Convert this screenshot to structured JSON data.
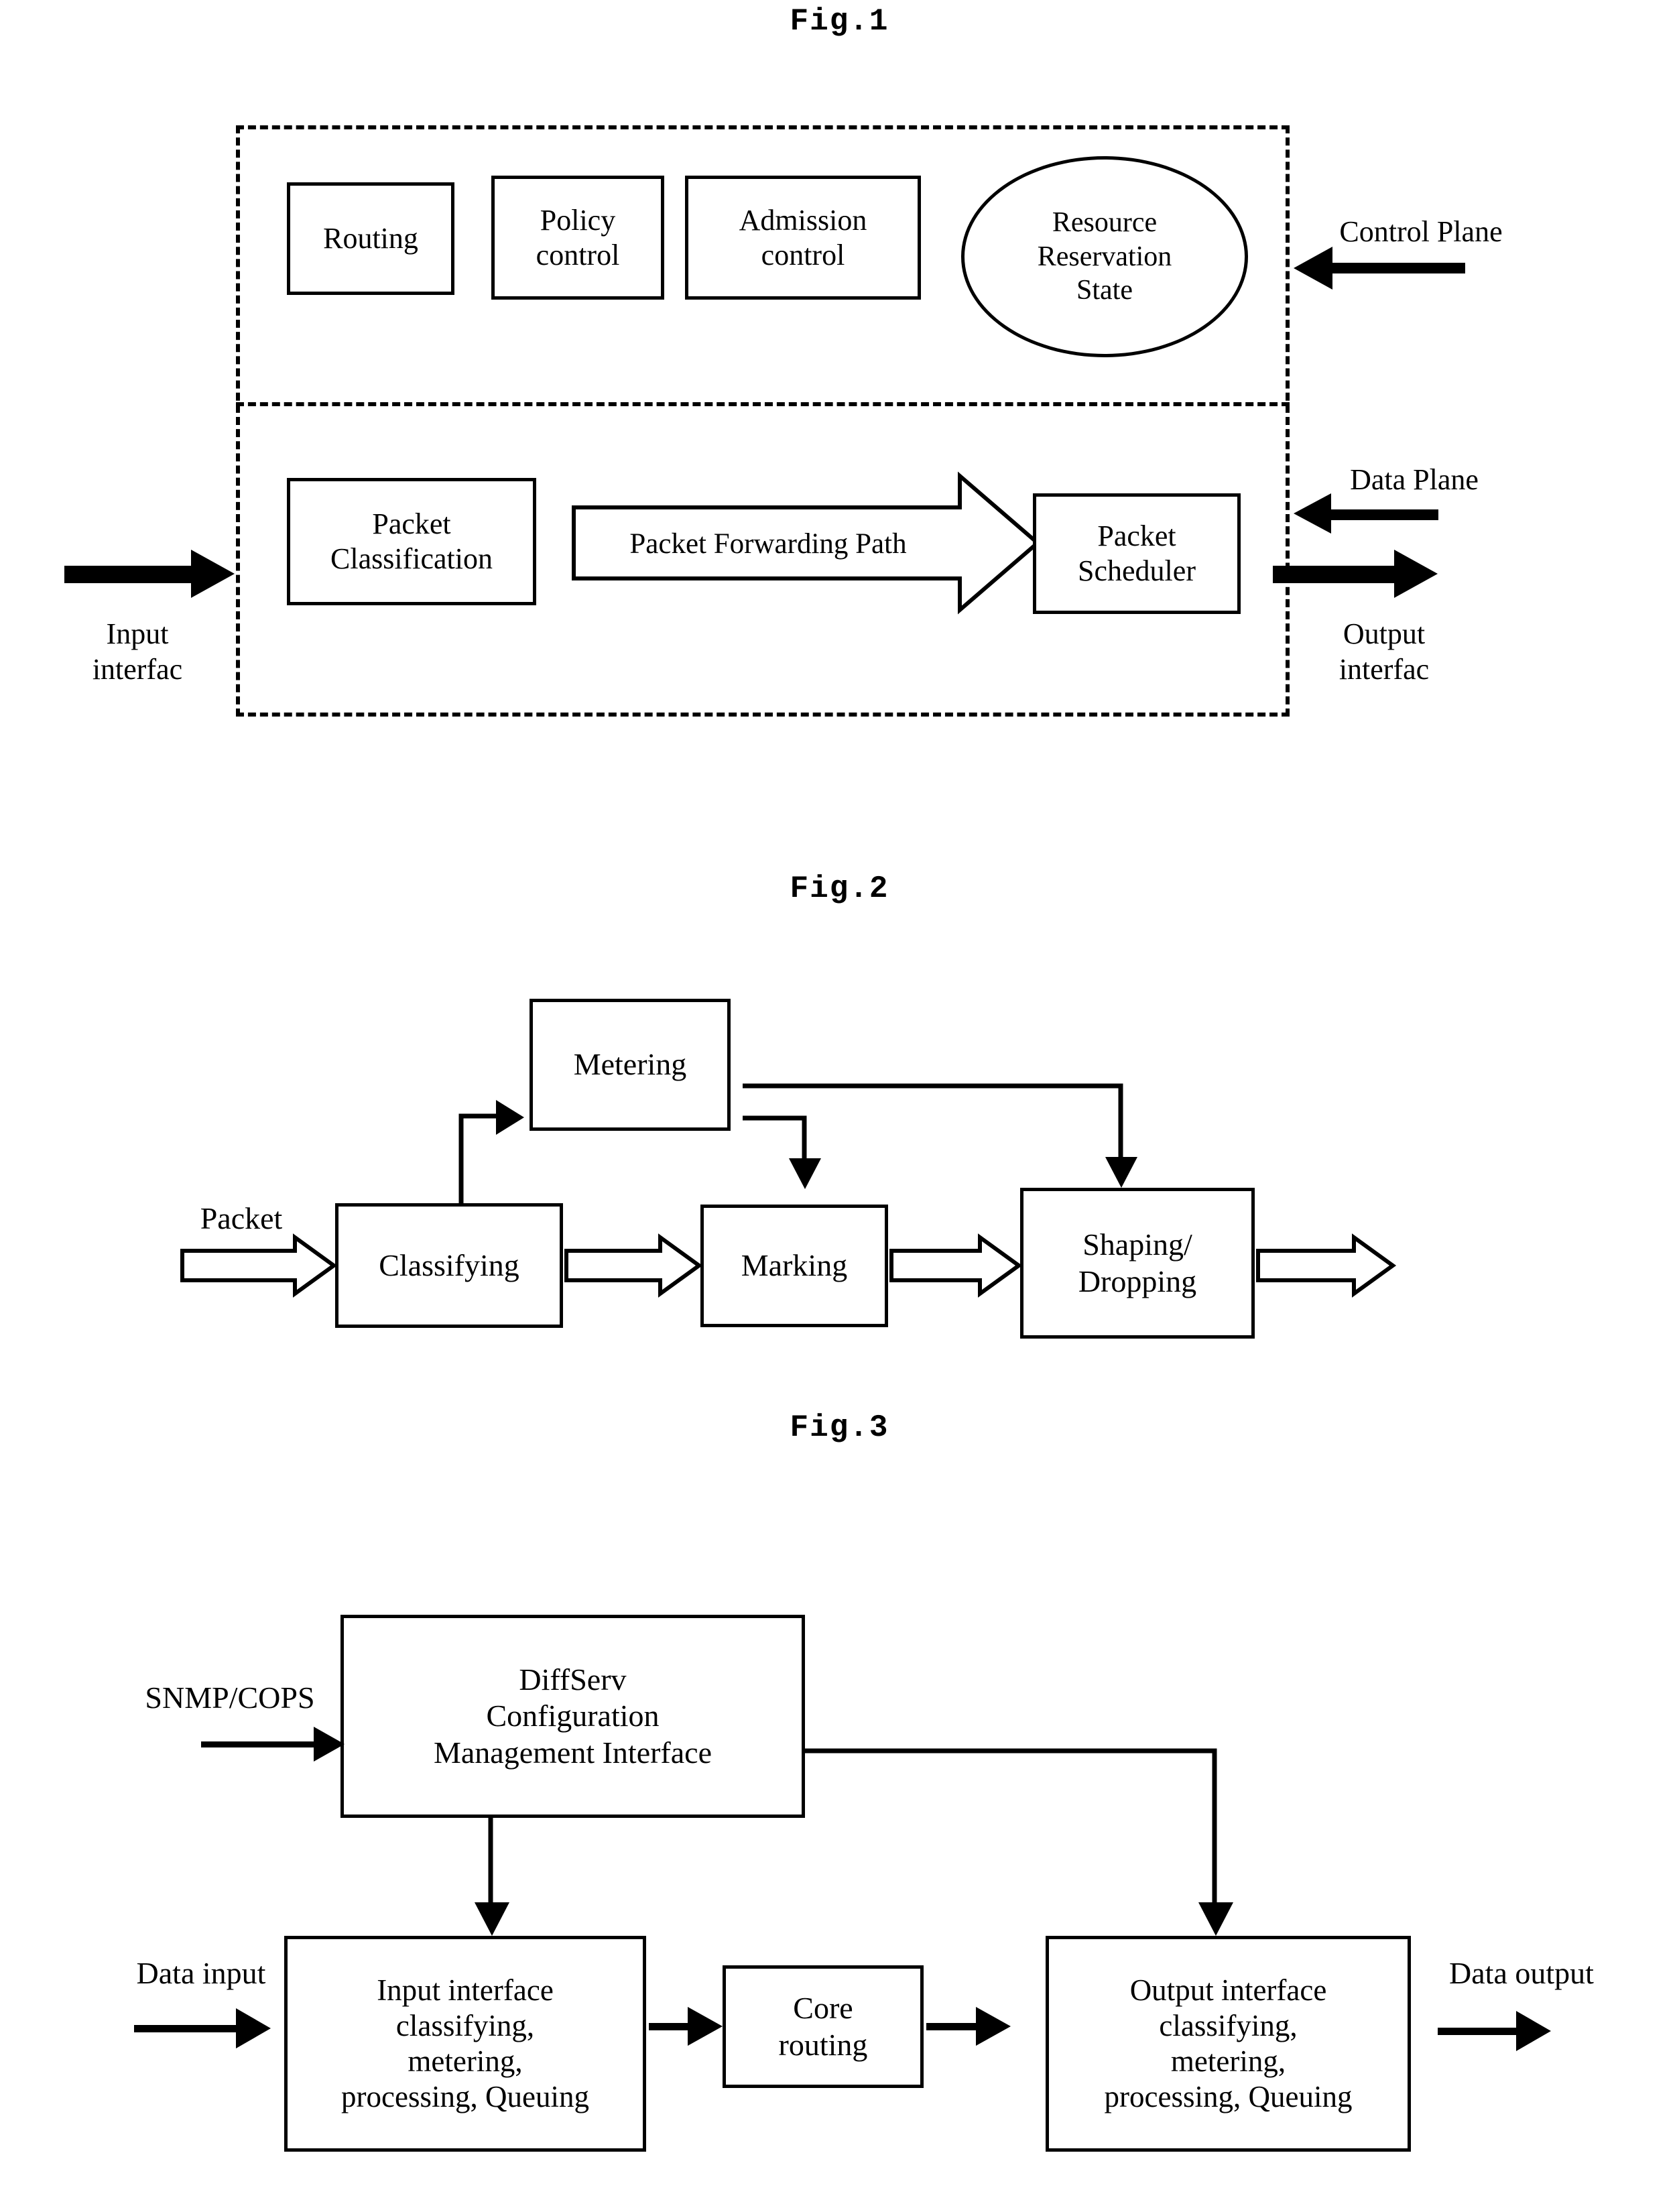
{
  "figures": [
    {
      "caption": "Fig.1",
      "control_plane": {
        "label": "Control Plane",
        "blocks": [
          {
            "label": "Routing"
          },
          {
            "label": "Policy\ncontrol"
          },
          {
            "label": "Admission\ncontrol"
          }
        ],
        "ellipse": {
          "label": "Resource\nReservation\nState"
        }
      },
      "data_plane": {
        "label": "Data Plane",
        "blocks": [
          {
            "label": "Packet\nClassification"
          },
          {
            "label": "Packet Forwarding Path"
          },
          {
            "label": "Packet\nScheduler"
          }
        ]
      },
      "input_label": "Input\ninterfac",
      "output_label": "Output\ninterfac"
    },
    {
      "caption": "Fig.2",
      "blocks": [
        {
          "label": "Metering"
        },
        {
          "label": "Classifying"
        },
        {
          "label": "Marking"
        },
        {
          "label": "Shaping/\nDropping"
        }
      ],
      "input_label": "Packet"
    },
    {
      "caption": "Fig.3",
      "blocks": [
        {
          "label": "DiffServ\nConfiguration\nManagement Interface"
        },
        {
          "label": "Input interface\nclassifying,\nmetering,\nprocessing, Queuing"
        },
        {
          "label": "Core\nrouting"
        },
        {
          "label": "Output interface\nclassifying,\nmetering,\nprocessing, Queuing"
        }
      ],
      "management_input_label": "SNMP/COPS",
      "data_input_label": "Data input",
      "data_output_label": "Data output"
    }
  ],
  "colors": {
    "ink": "#000000",
    "paper": "#ffffff"
  }
}
